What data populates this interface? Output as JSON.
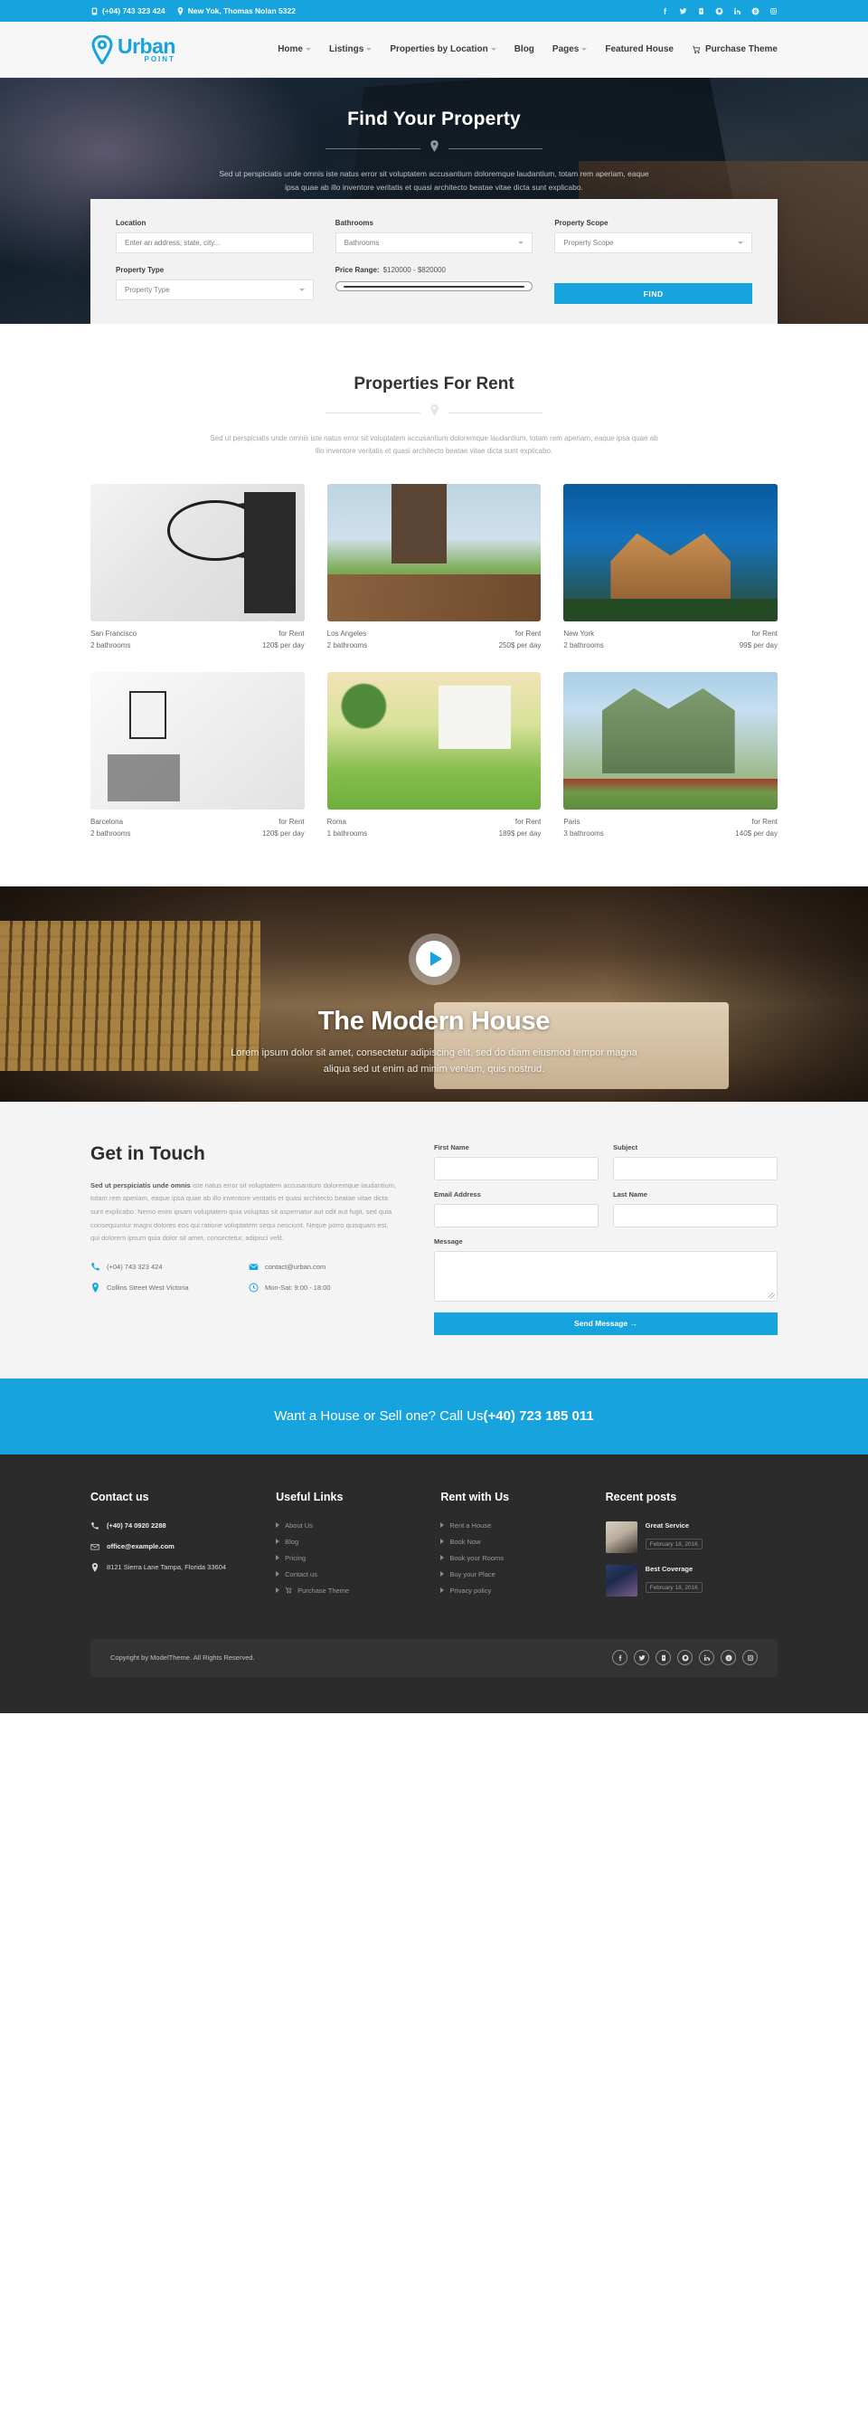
{
  "colors": {
    "brand": "#17a3dd",
    "footer_bg": "#2b2b2b",
    "contact_bg": "#f4f4f4"
  },
  "topbar": {
    "phone": "(+04) 743 323 424",
    "address": "New Yok, Thomas Nolan 5322",
    "social": [
      "facebook-icon",
      "twitter-icon",
      "youtube-icon",
      "pinterest-icon",
      "linkedin-icon",
      "skype-icon",
      "instagram-icon"
    ]
  },
  "nav": {
    "logo_main": "Urban",
    "logo_sub": "POINT",
    "items": [
      {
        "label": "Home",
        "caret": true
      },
      {
        "label": "Listings",
        "caret": true
      },
      {
        "label": "Properties by Location",
        "caret": true
      },
      {
        "label": "Blog",
        "caret": false
      },
      {
        "label": "Pages",
        "caret": true
      },
      {
        "label": "Featured House",
        "caret": false
      },
      {
        "label": "Purchase Theme",
        "caret": false,
        "cart": true
      }
    ]
  },
  "hero": {
    "title": "Find Your Property",
    "subtitle": "Sed ut perspiciatis unde omnis iste natus error sit voluptatem accusantium doloremque laudantium, totam rem aperiam, eaque ipsa quae ab illo inventore veritatis et quasi architecto beatae vitae dicta sunt explicabo.",
    "search": {
      "location_label": "Location",
      "location_placeholder": "Enter an address, state, city...",
      "bathrooms_label": "Bathrooms",
      "bathrooms_value": "Bathrooms",
      "scope_label": "Property Scope",
      "scope_value": "Property Scope",
      "type_label": "Property Type",
      "type_value": "Property Type",
      "price_label": "Price Range:",
      "price_value": "$120000 - $820000",
      "find_label": "FIND"
    }
  },
  "properties_section": {
    "title": "Properties For Rent",
    "subtitle": "Sed ut perspiciatis unde omnis iste natus error sit voluptatem accusantium doloremque laudantium, totam rem aperiam, eaque ipsa quae ab illo inventore veritatis et quasi architecto beatae vitae dicta sunt explicabo.",
    "cards": [
      {
        "city": "San Francisco",
        "status": "for Rent",
        "bathrooms": "2 bathrooms",
        "price": "120$ per day",
        "img": "img-sf"
      },
      {
        "city": "Los Angeles",
        "status": "for Rent",
        "bathrooms": "2 bathrooms",
        "price": "250$ per day",
        "img": "img-la"
      },
      {
        "city": "New York",
        "status": "for Rent",
        "bathrooms": "2 bathrooms",
        "price": "99$ per day",
        "img": "img-ny"
      },
      {
        "city": "Barcelona",
        "status": "for Rent",
        "bathrooms": "2 bathrooms",
        "price": "120$ per day",
        "img": "img-bcn"
      },
      {
        "city": "Roma",
        "status": "for Rent",
        "bathrooms": "1 bathrooms",
        "price": "189$ per day",
        "img": "img-roma"
      },
      {
        "city": "Paris",
        "status": "for Rent",
        "bathrooms": "3 bathrooms",
        "price": "140$ per day",
        "img": "img-paris"
      }
    ]
  },
  "modern_house": {
    "title": "The Modern House",
    "subtitle": "Lorem ipsum dolor sit amet, consectetur adipiscing elit, sed do diam eiusmod tempor magna aliqua sed ut enim ad minim veniam, quis nostrud."
  },
  "contact": {
    "title": "Get in Touch",
    "body_bold": "Sed ut perspiciatis unde omnis",
    "body_rest": " iste natus error sit voluptatem accusantium doloremque laudantium, totam rem aperiam, eaque ipsa quae ab illo inventore veritatis et quasi architecto beatae vitae dicta sunt explicabo. Nemo enim ipsam voluptatem quia voluptas sit aspernatur aut odit aut fugit, sed quia consequuntur magni dolores eos qui ratione voluptatem sequi nesciunt. Neque porro quisquam est, qui dolorem ipsum quia dolor sit amet, consectetur, adipisci velit.",
    "phone": "(+04) 743 323 424",
    "email": "contact@urban.com",
    "address": "Collins Street West Victoria",
    "hours": "Mon-Sat: 9:00 - 18:00",
    "form": {
      "first_name_label": "First Name",
      "subject_label": "Subject",
      "email_label": "Email Address",
      "last_name_label": "Last Name",
      "message_label": "Message",
      "submit_label": "Send Message →"
    }
  },
  "cta": {
    "text": "Want a House or Sell one? Call Us ",
    "phone": "(+40) 723 185 011"
  },
  "footer": {
    "contact": {
      "heading": "Contact us",
      "phone": "(+40) 74 0920 2288",
      "email": "office@example.com",
      "address": "8121 Sierra Lane Tampa, Florida 33604"
    },
    "useful": {
      "heading": "Useful Links",
      "links": [
        "About Us",
        "Blog",
        "Pricing",
        "Contact us",
        "Purchase Theme"
      ]
    },
    "rent": {
      "heading": "Rent with Us",
      "links": [
        "Rent a House",
        "Book Now",
        "Book your Rooms",
        "Buy your Place",
        "Privacy policy"
      ]
    },
    "posts": {
      "heading": "Recent posts",
      "items": [
        {
          "title": "Great Service",
          "date": "February 18, 2016",
          "img": "fp-1"
        },
        {
          "title": "Best Coverage",
          "date": "February 18, 2016",
          "img": "fp-2"
        }
      ]
    },
    "copyright": "Copyright by ModelTheme. All Rights Reserved.",
    "social": [
      "facebook-icon",
      "twitter-icon",
      "youtube-icon",
      "pinterest-icon",
      "linkedin-icon",
      "skype-icon",
      "instagram-icon"
    ]
  }
}
